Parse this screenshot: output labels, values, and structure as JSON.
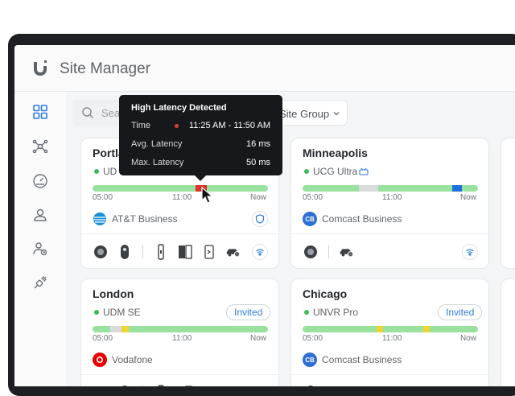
{
  "app": {
    "title": "Site Manager"
  },
  "search": {
    "placeholder": "Search"
  },
  "filter": {
    "label": "Site Group"
  },
  "sidebar": {
    "items": [
      {
        "icon": "dashboard-grid-icon",
        "active": true
      },
      {
        "icon": "topology-icon"
      },
      {
        "icon": "speedometer-icon"
      },
      {
        "icon": "support-icon"
      },
      {
        "icon": "users-icon"
      },
      {
        "icon": "integrations-icon"
      }
    ]
  },
  "tooltip": {
    "title": "High Latency Detected",
    "time_label": "Time",
    "time_value": "11:25 AM - 11:50 AM",
    "avg_label": "Avg. Latency",
    "avg_value": "16 ms",
    "max_label": "Max. Latency",
    "max_value": "50 ms"
  },
  "sites": [
    {
      "name": "Portland",
      "visible_name": "Portla",
      "device": "UDM",
      "visible_device": "UD",
      "ticks": [
        "05:00",
        "11:00",
        "Now"
      ],
      "isp": "AT&T Business",
      "isp_icon": "att-logo-icon",
      "corner_icon": "shield-icon"
    },
    {
      "name": "Minneapolis",
      "device": "UCG Ultra",
      "ticks": [
        "05:00",
        "11:00",
        "Now"
      ],
      "isp": "Comcast Business",
      "isp_icon": "comcast-logo-icon",
      "corner_icon": "wifi-signal-icon"
    },
    {
      "name": "London",
      "device": "UDM SE",
      "badge": "Invited",
      "ticks": [
        "05:00",
        "11:00",
        "Now"
      ],
      "isp": "Vodafone",
      "isp_icon": "vodafone-logo-icon"
    },
    {
      "name": "Chicago",
      "device": "UNVR Pro",
      "badge": "Invited",
      "ticks": [
        "05:00",
        "11:00",
        "Now"
      ],
      "isp": "Comcast Business",
      "isp_icon": "comcast-logo-icon"
    }
  ],
  "colors": {
    "healthy": "#98e19e",
    "warning": "#f2d332",
    "offline": "#d9dadc",
    "critical": "#d9342b",
    "info": "#1f6fe0",
    "accent": "#2f7de1"
  }
}
